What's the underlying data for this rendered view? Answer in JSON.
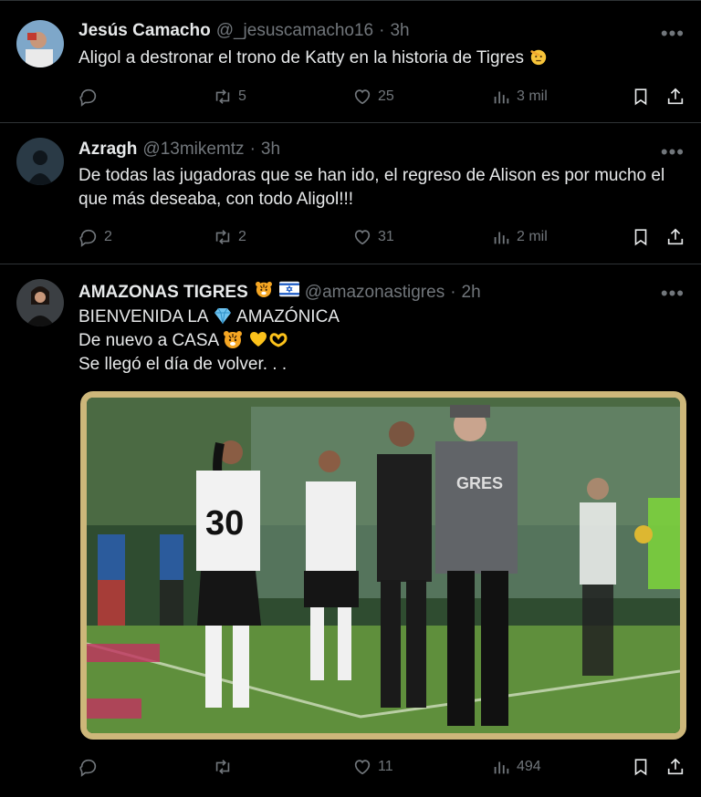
{
  "tweets": [
    {
      "name": "Jesús Camacho",
      "handle": "@_jesuscamacho16",
      "separator": "·",
      "time": "3h",
      "text": "Aligol a destronar el trono de Katty en la historia de Tigres",
      "replies": "",
      "retweets": "5",
      "likes": "25",
      "views": "3 mil"
    },
    {
      "name": "Azragh",
      "handle": "@13mikemtz",
      "separator": "·",
      "time": "3h",
      "text": "De todas las jugadoras que se han ido, el regreso de Alison es por mucho el que más deseaba, con todo Aligol!!!",
      "replies": "2",
      "retweets": "2",
      "likes": "31",
      "views": "2 mil"
    },
    {
      "name": "AMAZONAS TIGRES",
      "handle": "@amazonastigres",
      "separator": "·",
      "time": "2h",
      "text_line1": "BIENVENIDA LA",
      "text_line1b": "AMAZÓNICA",
      "text_line2": "De nuevo a CASA",
      "text_line3": "Se llegó el día de volver. . .",
      "replies": "",
      "retweets": "",
      "likes": "11",
      "views": "494"
    }
  ],
  "colors": {
    "background": "#000000",
    "text": "#e7e9ea",
    "muted": "#71767b",
    "divider": "#2f3336",
    "media_frame": "#cdb77a"
  },
  "icons": [
    "reply-icon",
    "retweet-icon",
    "heart-icon",
    "views-icon",
    "bookmark-icon",
    "share-icon",
    "more-icon"
  ]
}
